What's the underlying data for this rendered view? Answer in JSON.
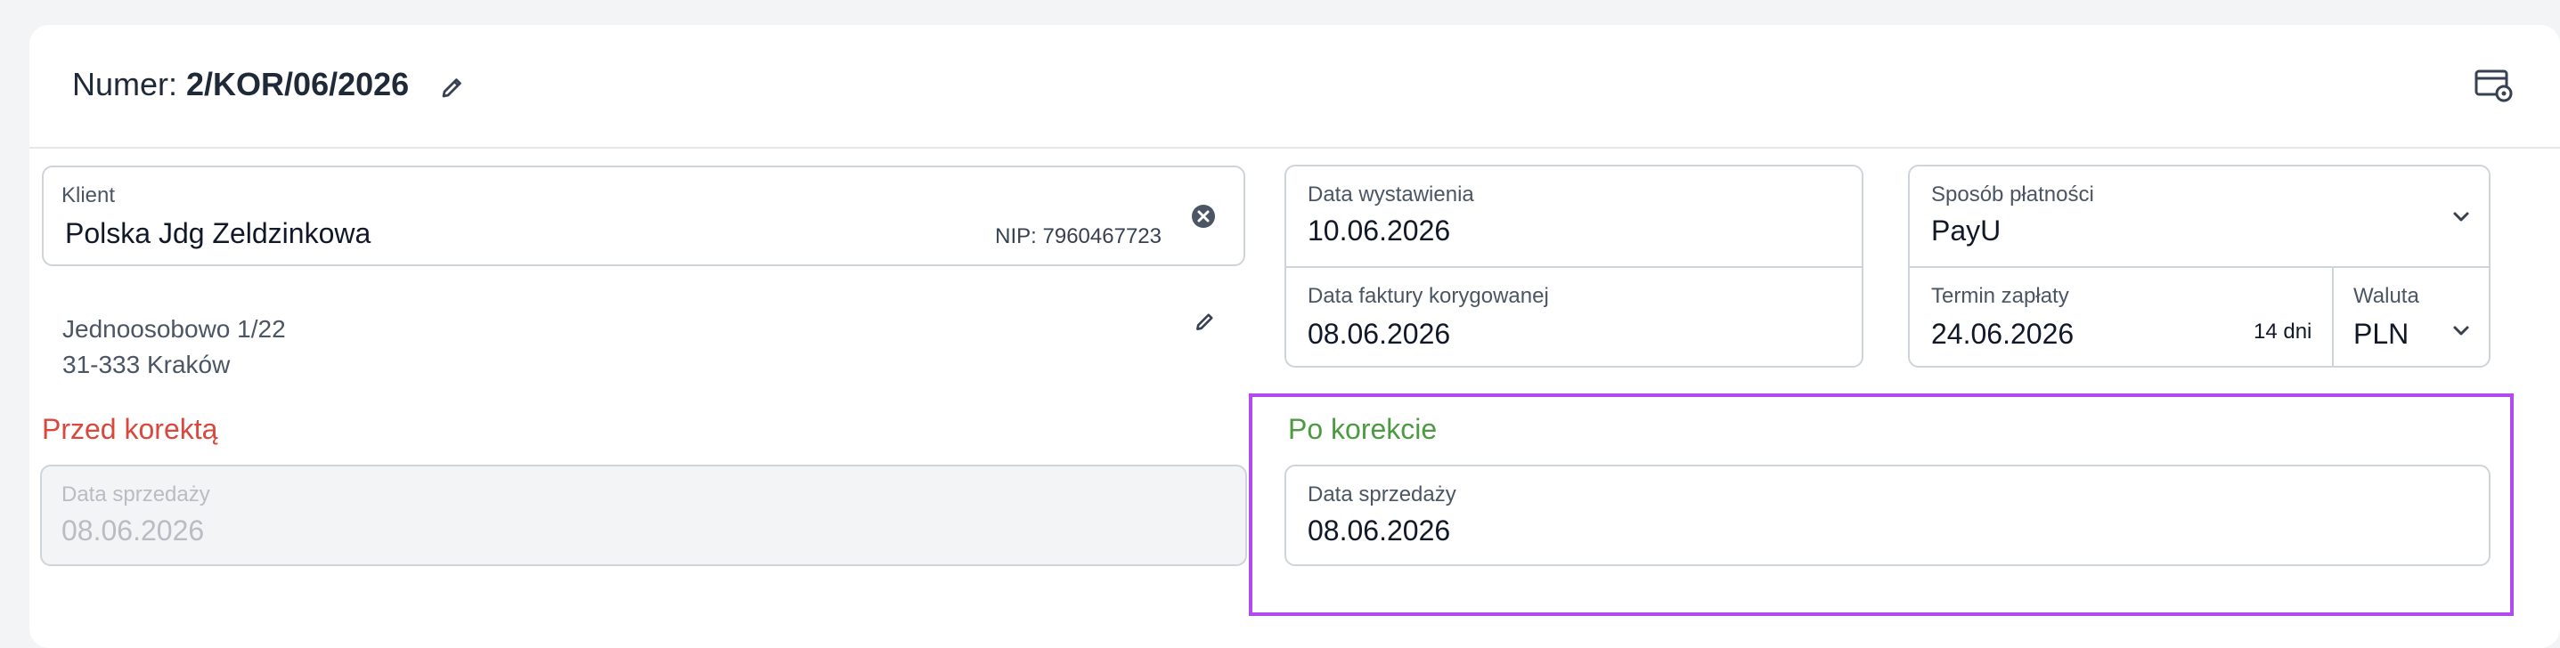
{
  "header": {
    "number_label": "Numer:",
    "number_value": "2/KOR/06/2026"
  },
  "client": {
    "label": "Klient",
    "name": "Polska Jdg Zeldzinkowa",
    "nip": "NIP: 7960467723",
    "address_line1": "Jednoosobowo 1/22",
    "address_line2": "31-333 Kraków"
  },
  "dates": {
    "issue_label": "Data wystawienia",
    "issue_value": "10.06.2026",
    "corrected_label": "Data faktury korygowanej",
    "corrected_value": "08.06.2026"
  },
  "payment": {
    "method_label": "Sposób płatności",
    "method_value": "PayU",
    "due_label": "Termin zapłaty",
    "due_value": "24.06.2026",
    "due_days": "14 dni",
    "currency_label": "Waluta",
    "currency_value": "PLN"
  },
  "before": {
    "title": "Przed korektą",
    "sale_label": "Data sprzedaży",
    "sale_value": "08.06.2026"
  },
  "after": {
    "title": "Po korekcie",
    "sale_label": "Data sprzedaży",
    "sale_value": "08.06.2026"
  },
  "colors": {
    "before": "#d9473d",
    "after": "#4c9a42",
    "highlight": "#b14bf0"
  }
}
